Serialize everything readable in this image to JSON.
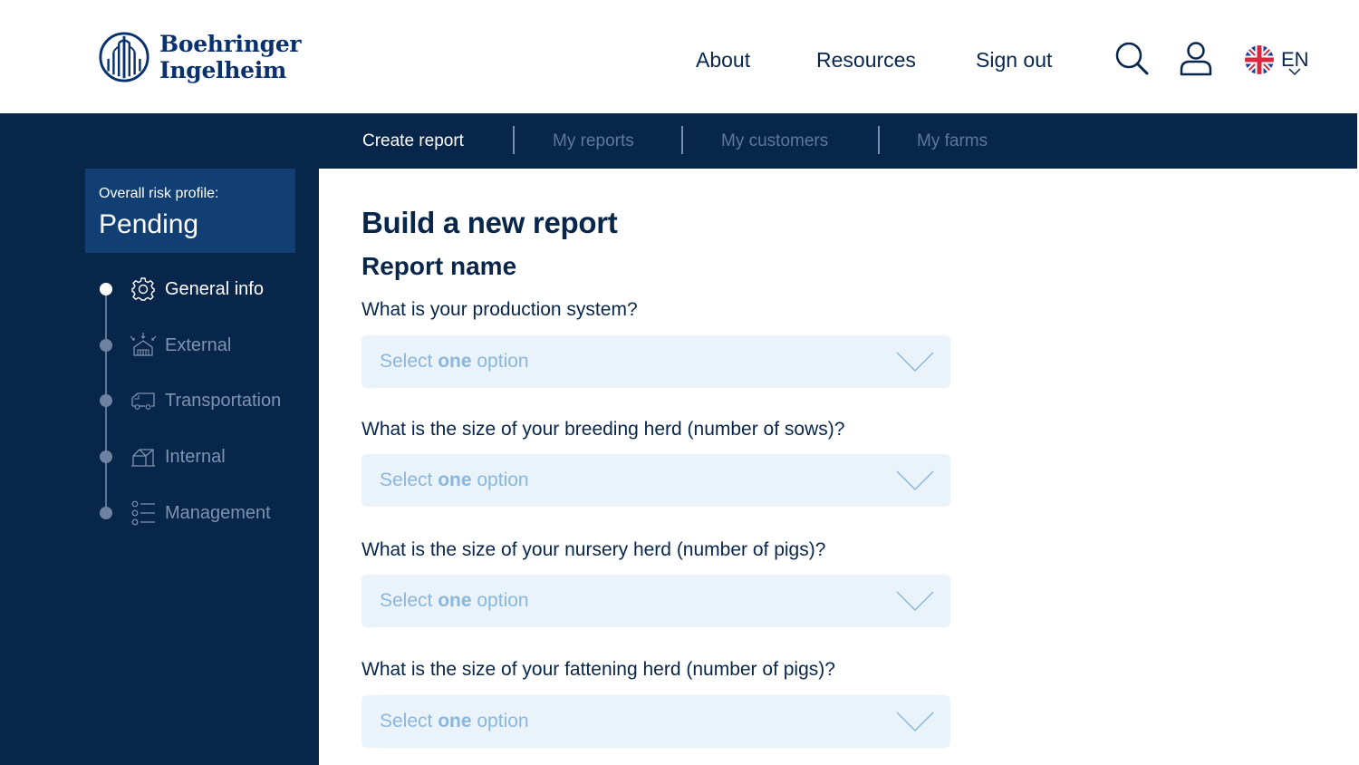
{
  "brand": {
    "line1": "Boehringer",
    "line2": "Ingelheim",
    "color": "#08316e"
  },
  "header": {
    "nav": [
      "About",
      "Resources",
      "Sign out"
    ],
    "icons": [
      "search-icon",
      "user-icon",
      "uk-flag-icon"
    ],
    "language": "EN"
  },
  "subnav": {
    "tabs": [
      {
        "label": "Create report",
        "active": true
      },
      {
        "label": "My reports",
        "active": false
      },
      {
        "label": "My customers",
        "active": false
      },
      {
        "label": "My farms",
        "active": false
      }
    ]
  },
  "sidebar": {
    "risk_label": "Overall risk profile:",
    "risk_value": "Pending",
    "steps": [
      {
        "label": "General info",
        "icon": "gear-icon",
        "active": true
      },
      {
        "label": "External",
        "icon": "external-icon",
        "active": false
      },
      {
        "label": "Transportation",
        "icon": "truck-icon",
        "active": false
      },
      {
        "label": "Internal",
        "icon": "barn-icon",
        "active": false
      },
      {
        "label": "Management",
        "icon": "list-icon",
        "active": false
      }
    ]
  },
  "main": {
    "title": "Build a new report",
    "subtitle": "Report name",
    "questions": [
      {
        "label": "What is your production system?",
        "placeholder_pre": "Select ",
        "placeholder_bold": "one",
        "placeholder_post": " option"
      },
      {
        "label": "What is the size of your breeding herd (number of sows)?",
        "placeholder_pre": "Select ",
        "placeholder_bold": "one",
        "placeholder_post": " option"
      },
      {
        "label": "What is the size of your nursery herd (number of pigs)?",
        "placeholder_pre": "Select ",
        "placeholder_bold": "one",
        "placeholder_post": " option"
      },
      {
        "label": "What is the size of your fattening herd (number of pigs)?",
        "placeholder_pre": "Select ",
        "placeholder_bold": "one",
        "placeholder_post": " option"
      }
    ]
  },
  "colors": {
    "navy": "#08254a",
    "accent_box": "#123f73",
    "select_bg": "#eaf2fa",
    "placeholder": "#8ab7de"
  }
}
